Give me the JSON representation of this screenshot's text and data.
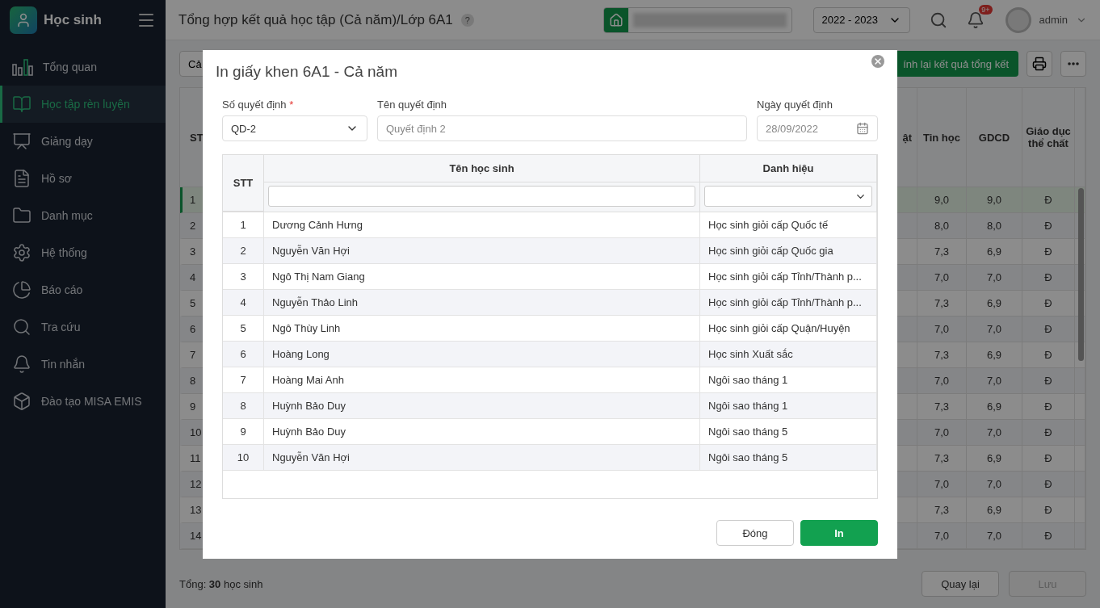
{
  "sidebar": {
    "app_name": "Học sinh",
    "items": [
      {
        "label": "Tổng quan",
        "selected": false
      },
      {
        "label": "Học tập rèn luyện",
        "selected": true
      },
      {
        "label": "Giảng dạy",
        "selected": false
      },
      {
        "label": "Hồ sơ",
        "selected": false
      },
      {
        "label": "Danh mục",
        "selected": false
      },
      {
        "label": "Hệ thống",
        "selected": false
      },
      {
        "label": "Báo cáo",
        "selected": false
      },
      {
        "label": "Tra cứu",
        "selected": false
      },
      {
        "label": "Tin nhắn",
        "selected": false
      },
      {
        "label": "Đào tạo MISA EMIS",
        "selected": false
      }
    ]
  },
  "header": {
    "title": "Tổng hợp kết quả học tập (Cả năm)/Lớp 6A1",
    "help": "?",
    "year": "2022 - 2023",
    "notifications": "9+",
    "user": "admin"
  },
  "toolbar": {
    "period_select": "Cả",
    "recalc_button": "ính lại kết quả tổng kết"
  },
  "background_table": {
    "columns": [
      "ST",
      "ật",
      "Tin học",
      "GDCD",
      "Giáo dục thể chất"
    ],
    "rows": [
      {
        "cells": [
          "1",
          "",
          "9,0",
          "9,0",
          "Đ"
        ],
        "selected": true
      },
      {
        "cells": [
          "2",
          "",
          "8,0",
          "8,0",
          "Đ"
        ],
        "selected": false
      },
      {
        "cells": [
          "3",
          "",
          "7,3",
          "6,9",
          "Đ"
        ],
        "selected": false
      },
      {
        "cells": [
          "4",
          "",
          "7,0",
          "7,0",
          "Đ"
        ],
        "selected": false
      },
      {
        "cells": [
          "5",
          "",
          "7,3",
          "6,9",
          "Đ"
        ],
        "selected": false
      },
      {
        "cells": [
          "6",
          "",
          "7,0",
          "7,0",
          "Đ"
        ],
        "selected": false
      },
      {
        "cells": [
          "7",
          "",
          "7,3",
          "6,9",
          "Đ"
        ],
        "selected": false
      },
      {
        "cells": [
          "8",
          "",
          "7,0",
          "7,0",
          "Đ"
        ],
        "selected": false
      },
      {
        "cells": [
          "9",
          "",
          "7,3",
          "6,9",
          "Đ"
        ],
        "selected": false
      },
      {
        "cells": [
          "10",
          "",
          "7,0",
          "7,0",
          "Đ"
        ],
        "selected": false
      },
      {
        "cells": [
          "11",
          "",
          "7,3",
          "6,9",
          "Đ"
        ],
        "selected": false
      },
      {
        "cells": [
          "12",
          "",
          "7,0",
          "7,0",
          "Đ"
        ],
        "selected": false
      },
      {
        "cells": [
          "13",
          "",
          "7,3",
          "6,9",
          "Đ"
        ],
        "selected": false
      },
      {
        "cells": [
          "14",
          "",
          "7,0",
          "7,0",
          "Đ"
        ],
        "selected": false
      }
    ]
  },
  "footer": {
    "total": "Tổng: **30** học sinh",
    "buttons": [
      {
        "label": "Quay lại",
        "disabled": false
      },
      {
        "label": "Lưu",
        "disabled": true
      }
    ]
  },
  "dialog": {
    "title": "In giấy khen 6A1 - Cả năm",
    "fields": [
      {
        "kind": "select",
        "label": "Số quyết định",
        "required_mark": "*",
        "value": "QD-2"
      },
      {
        "kind": "text",
        "label": "Tên quyết định",
        "placeholder": "Quyết định 2"
      },
      {
        "kind": "date",
        "label": "Ngày quyết định",
        "value": "28/09/2022",
        "disabled": true
      }
    ],
    "columns": [
      "STT",
      "Tên học sinh",
      "Danh hiệu"
    ],
    "rows": [
      {
        "stt": "1",
        "name": "Dương Cảnh Hưng",
        "title": "Học sinh giỏi cấp Quốc tế"
      },
      {
        "stt": "2",
        "name": "Nguyễn Văn Hợi",
        "title": "Học sinh giỏi cấp Quốc gia"
      },
      {
        "stt": "3",
        "name": "Ngô Thị Nam Giang",
        "title": "Học sinh giỏi cấp Tỉnh/Thành p..."
      },
      {
        "stt": "4",
        "name": "Nguyễn Thảo Linh",
        "title": "Học sinh giỏi cấp Tỉnh/Thành p..."
      },
      {
        "stt": "5",
        "name": "Ngô Thùy Linh",
        "title": "Học sinh giỏi cấp Quận/Huyện"
      },
      {
        "stt": "6",
        "name": "Hoàng Long",
        "title": "Học sinh Xuất sắc"
      },
      {
        "stt": "7",
        "name": "Hoàng Mai Anh",
        "title": "Ngôi sao tháng 1"
      },
      {
        "stt": "8",
        "name": "Huỳnh Bảo Duy",
        "title": "Ngôi sao tháng 1"
      },
      {
        "stt": "9",
        "name": "Huỳnh Bảo Duy",
        "title": "Ngôi sao tháng 5"
      },
      {
        "stt": "10",
        "name": "Nguyễn Văn Hợi",
        "title": "Ngôi sao tháng 5"
      }
    ],
    "buttons": [
      {
        "kind": "secondary",
        "label": "Đóng"
      },
      {
        "kind": "primary",
        "label": "In"
      }
    ]
  }
}
